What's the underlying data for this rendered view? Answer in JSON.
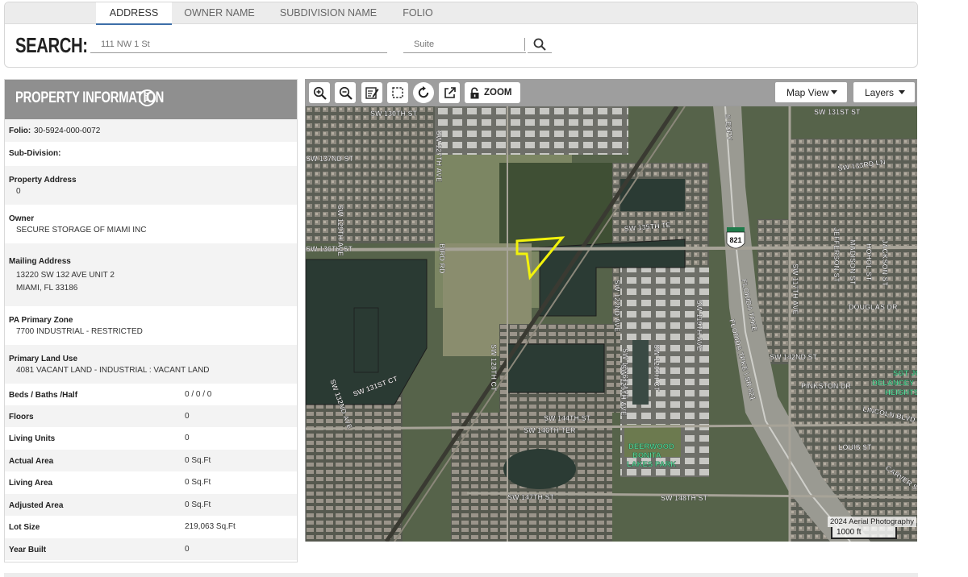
{
  "search": {
    "tabs": [
      {
        "label": "ADDRESS",
        "active": true
      },
      {
        "label": "OWNER NAME",
        "active": false
      },
      {
        "label": "SUBDIVISION NAME",
        "active": false
      },
      {
        "label": "FOLIO",
        "active": false
      }
    ],
    "label": "SEARCH:",
    "address_placeholder": "111 NW 1 St",
    "suite_placeholder": "Suite",
    "search_icon": "search-icon"
  },
  "property": {
    "title": "PROPERTY INFORMATION",
    "info_icon": "info-icon",
    "folio_label": "Folio:",
    "folio_value": "30-5924-000-0072",
    "subdivision_label": "Sub-Division:",
    "address_label": "Property Address",
    "address_value": "0",
    "owner_label": "Owner",
    "owner_value": "SECURE STORAGE OF MIAMI INC",
    "mailing_label": "Mailing Address",
    "mailing_line1": "13220 SW 132 AVE UNIT 2",
    "mailing_line2": "MIAMI, FL 33186",
    "zone_label": "PA Primary Zone",
    "zone_value": "7700 INDUSTRIAL - RESTRICTED",
    "land_use_label": "Primary Land Use",
    "land_use_value": "4081 VACANT LAND - INDUSTRIAL : VACANT LAND",
    "stats": [
      {
        "label": "Beds / Baths /Half",
        "value": "0 / 0 / 0"
      },
      {
        "label": "Floors",
        "value": "0"
      },
      {
        "label": "Living Units",
        "value": "0"
      },
      {
        "label": "Actual Area",
        "value": "0 Sq.Ft"
      },
      {
        "label": "Living Area",
        "value": "0 Sq.Ft"
      },
      {
        "label": "Adjusted Area",
        "value": "0 Sq.Ft"
      },
      {
        "label": "Lot Size",
        "value": "219,063 Sq.Ft"
      },
      {
        "label": "Year Built",
        "value": "0"
      }
    ]
  },
  "map": {
    "tools": [
      "zoom-in-icon",
      "zoom-out-icon",
      "edit-icon",
      "select-box-icon",
      "refresh-icon",
      "external-link-icon",
      "lock-icon"
    ],
    "zoom_label": "ZOOM",
    "map_view_label": "Map View",
    "layers_label": "Layers",
    "attribution": "2024 Aerial Photography",
    "scale_label": "1000 ft",
    "highway_shield": "821",
    "park_label_1": "DEERWOOD",
    "park_label_2": "BONITA",
    "park_label_3": "LAKES PARK",
    "streets": {
      "sw130": "SW 130TH ST",
      "sw133ln": "SW 133RD LN",
      "sw135te": "SW 135TH TE",
      "sw136": "SW 136TH ST",
      "sw137nd": "SW 137ND ST",
      "sw142": "SW 142ND ST",
      "sw144": "SW 144TH ST",
      "sw146te": "SW 146TH TER",
      "sw147": "SW 147TH ST",
      "sw148": "SW 148TH ST",
      "fl_tpke": "FLORIDA TPKE",
      "sr821": "FLORIDA TPKE \\ SR 821",
      "sw117ave": "SW 117TH AVE",
      "sw127ave": "SW 127TH AVE",
      "sw129ave": "SW 129TH AVE",
      "douglas": "DOUGLAS DR",
      "pinkston": "PINKSTON DR",
      "lincoln": "LINCOLN BLVD",
      "louis": "LOUIS ST",
      "madison": "MADISON ST",
      "jefferson": "JEFFERSON ST",
      "hohol": "HOHOL ST",
      "jackson": "JACKSON ST",
      "carver": "CARVER ST",
      "sgt": "SGT JOE",
      "delancey": "DELANCEY",
      "heights": "HEIGHTS",
      "expy": "S EXPY",
      "sw121ave": "SW 121ST AVE",
      "sw122ave": "SW 122ND AVE",
      "sw120ct": "SW 120TH CT",
      "sw119ave": "SW 119TH AVE",
      "sw128ct": "SW 128TH CT",
      "sw125ave": "SW 125TH AVE",
      "sw132ave": "SW 132ND AVE",
      "sw131ct": "SW 131ST CT",
      "sw131st": "SW 131ST ST",
      "birdrd": "BIRD RD"
    }
  }
}
